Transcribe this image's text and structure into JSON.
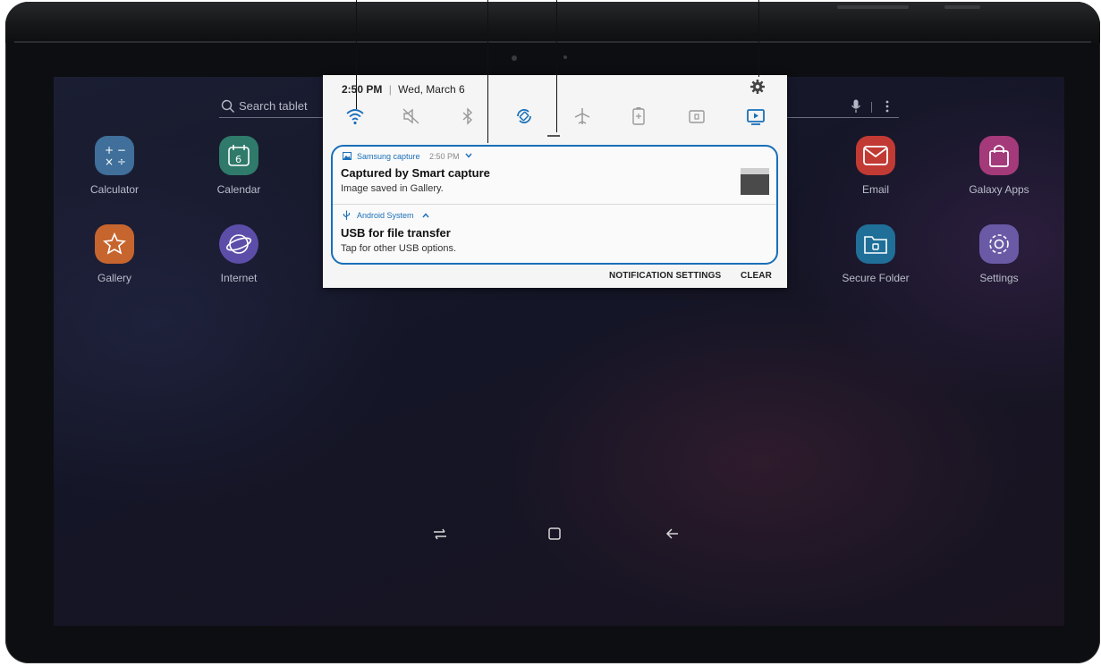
{
  "home": {
    "search_placeholder": "Search tablet",
    "apps": [
      {
        "label": "Calculator",
        "color": "#3f6f9a",
        "icon": "calculator-icon"
      },
      {
        "label": "Calendar",
        "color": "#2f7a6a",
        "icon": "calendar-icon",
        "badge": "6"
      },
      {
        "label": "Email",
        "color": "#c23a34",
        "icon": "email-icon"
      },
      {
        "label": "Galaxy Apps",
        "color": "#a43a7a",
        "icon": "galaxy-apps-icon"
      },
      {
        "label": "Gallery",
        "color": "#c7652e",
        "icon": "gallery-icon"
      },
      {
        "label": "Internet",
        "color": "#5c4ea8",
        "icon": "internet-icon"
      },
      {
        "label": "Secure Folder",
        "color": "#1f6f98",
        "icon": "secure-folder-icon"
      },
      {
        "label": "Settings",
        "color": "#6a5aa6",
        "icon": "settings-icon"
      }
    ]
  },
  "panel": {
    "time": "2:50 PM",
    "date_separator": "|",
    "date": "Wed, March 6",
    "quick_settings": [
      "wifi-icon",
      "mute-icon",
      "bluetooth-icon",
      "auto-rotate-icon",
      "airplane-icon",
      "power-saving-icon",
      "secure-folder-toggle-icon",
      "smart-view-icon"
    ],
    "notifications": [
      {
        "app": "Samsung capture",
        "time": "2:50 PM",
        "title": "Captured by Smart capture",
        "body": "Image saved in Gallery."
      },
      {
        "app": "Android System",
        "title": "USB for file transfer",
        "body": "Tap for other USB options."
      }
    ],
    "actions": {
      "settings": "NOTIFICATION SETTINGS",
      "clear": "CLEAR"
    }
  },
  "colors": {
    "accent": "#1a6fb8",
    "panel_bg": "#f5f5f5"
  }
}
